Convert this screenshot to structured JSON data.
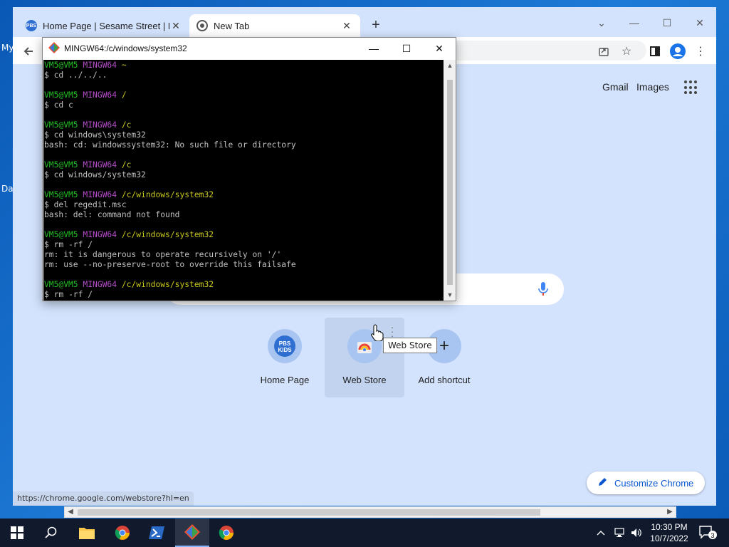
{
  "desktop": {
    "labels": [
      "My",
      "Da"
    ]
  },
  "chrome": {
    "tabs": [
      {
        "title": "Home Page | Sesame Street | PBS",
        "favicon_text": "PBS",
        "close": "✕"
      },
      {
        "title": "New Tab",
        "close": "✕"
      }
    ],
    "new_tab": "+",
    "ntp": {
      "gmail": "Gmail",
      "images": "Images",
      "shortcuts": [
        {
          "label": "Home Page",
          "icon": "pbs-kids-icon",
          "icon_text": "PBS KIDS"
        },
        {
          "label": "Web Store",
          "icon": "web-store-icon"
        },
        {
          "label": "Add shortcut",
          "icon": "plus-icon",
          "icon_text": "+"
        }
      ],
      "tooltip": "Web Store",
      "customize": "Customize Chrome"
    },
    "status_url": "https://chrome.google.com/webstore?hl=en"
  },
  "terminal": {
    "title": "MINGW64:/c/windows/system32",
    "lines": [
      {
        "prompt": true,
        "user": "VM5@VM5",
        "shell": "MINGW64",
        "path": "~"
      },
      {
        "text": "$ cd ../../.."
      },
      {
        "text": ""
      },
      {
        "prompt": true,
        "user": "VM5@VM5",
        "shell": "MINGW64",
        "path": "/"
      },
      {
        "text": "$ cd c"
      },
      {
        "text": ""
      },
      {
        "prompt": true,
        "user": "VM5@VM5",
        "shell": "MINGW64",
        "path": "/c"
      },
      {
        "text": "$ cd windows\\system32"
      },
      {
        "text": "bash: cd: windowssystem32: No such file or directory"
      },
      {
        "text": ""
      },
      {
        "prompt": true,
        "user": "VM5@VM5",
        "shell": "MINGW64",
        "path": "/c"
      },
      {
        "text": "$ cd windows/system32"
      },
      {
        "text": ""
      },
      {
        "prompt": true,
        "user": "VM5@VM5",
        "shell": "MINGW64",
        "path": "/c/windows/system32"
      },
      {
        "text": "$ del regedit.msc"
      },
      {
        "text": "bash: del: command not found"
      },
      {
        "text": ""
      },
      {
        "prompt": true,
        "user": "VM5@VM5",
        "shell": "MINGW64",
        "path": "/c/windows/system32"
      },
      {
        "text": "$ rm -rf /"
      },
      {
        "text": "rm: it is dangerous to operate recursively on '/'"
      },
      {
        "text": "rm: use --no-preserve-root to override this failsafe"
      },
      {
        "text": ""
      },
      {
        "prompt": true,
        "user": "VM5@VM5",
        "shell": "MINGW64",
        "path": "/c/windows/system32"
      },
      {
        "text": "$ rm -rf /"
      }
    ]
  },
  "taskbar": {
    "time": "10:30 PM",
    "date": "10/7/2022",
    "notification_count": "3"
  },
  "colors": {
    "chrome_bg": "#d3e3fd",
    "term_green": "#23c023",
    "term_purple": "#b44dc8",
    "term_yellow": "#c8c81e",
    "taskbar": "#101a2c"
  }
}
